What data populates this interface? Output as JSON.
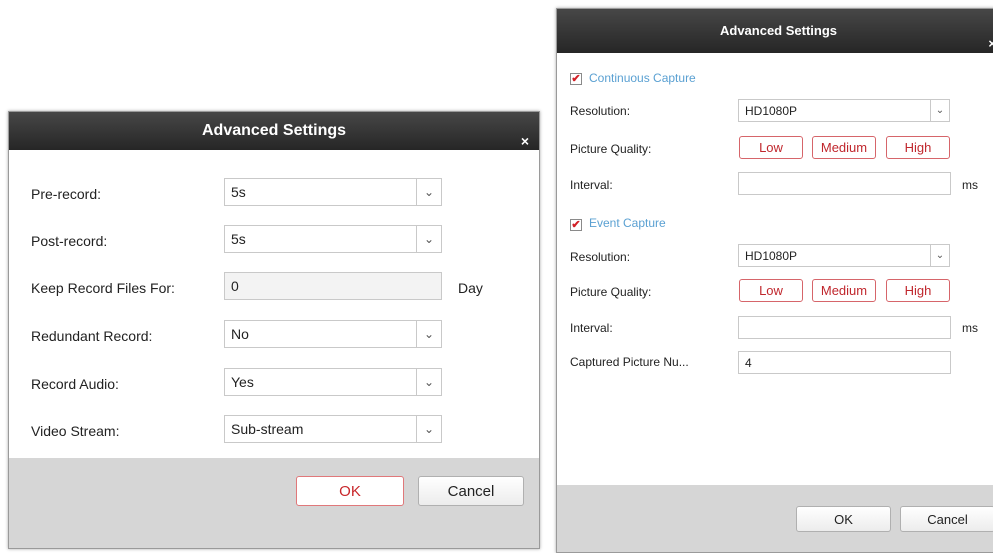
{
  "record_dialog": {
    "title": "Advanced Settings",
    "close_glyph": "×",
    "fields": [
      {
        "label": "Pre-record:",
        "value": "5s"
      },
      {
        "label": "Post-record:",
        "value": "5s"
      },
      {
        "label": "Keep Record Files For:",
        "value": "0",
        "unit": "Day"
      },
      {
        "label": "Redundant Record:",
        "value": "No"
      },
      {
        "label": "Record Audio:",
        "value": "Yes"
      },
      {
        "label": "Video Stream:",
        "value": "Sub-stream"
      }
    ],
    "ok_label": "OK",
    "cancel_label": "Cancel"
  },
  "capture_dialog": {
    "title": "Advanced Settings",
    "close_glyph": "×",
    "continuous": {
      "checked": true,
      "label": "Continuous Capture",
      "resolution_label": "Resolution:",
      "resolution_value": "HD1080P",
      "quality_label": "Picture Quality:",
      "quality_options": [
        "Low",
        "Medium",
        "High"
      ],
      "interval_label": "Interval:",
      "interval_value": "",
      "interval_unit": "ms"
    },
    "event": {
      "checked": true,
      "label": "Event Capture",
      "resolution_label": "Resolution:",
      "resolution_value": "HD1080P",
      "quality_label": "Picture Quality:",
      "quality_options": [
        "Low",
        "Medium",
        "High"
      ],
      "interval_label": "Interval:",
      "interval_value": "",
      "interval_unit": "ms",
      "captured_number_label": "Captured Picture Nu...",
      "captured_number_value": "4"
    },
    "ok_label": "OK",
    "cancel_label": "Cancel"
  },
  "icons": {
    "dropdown": "chevron-down-icon",
    "checkbox": "checkmark-icon",
    "close": "close-icon"
  },
  "colors": {
    "titlebar": "#2f2f2f",
    "primary_button_border": "#e0787a",
    "primary_button_text": "#c8272b",
    "section_label": "#5aa0d2",
    "checkmark": "#d21f26"
  }
}
